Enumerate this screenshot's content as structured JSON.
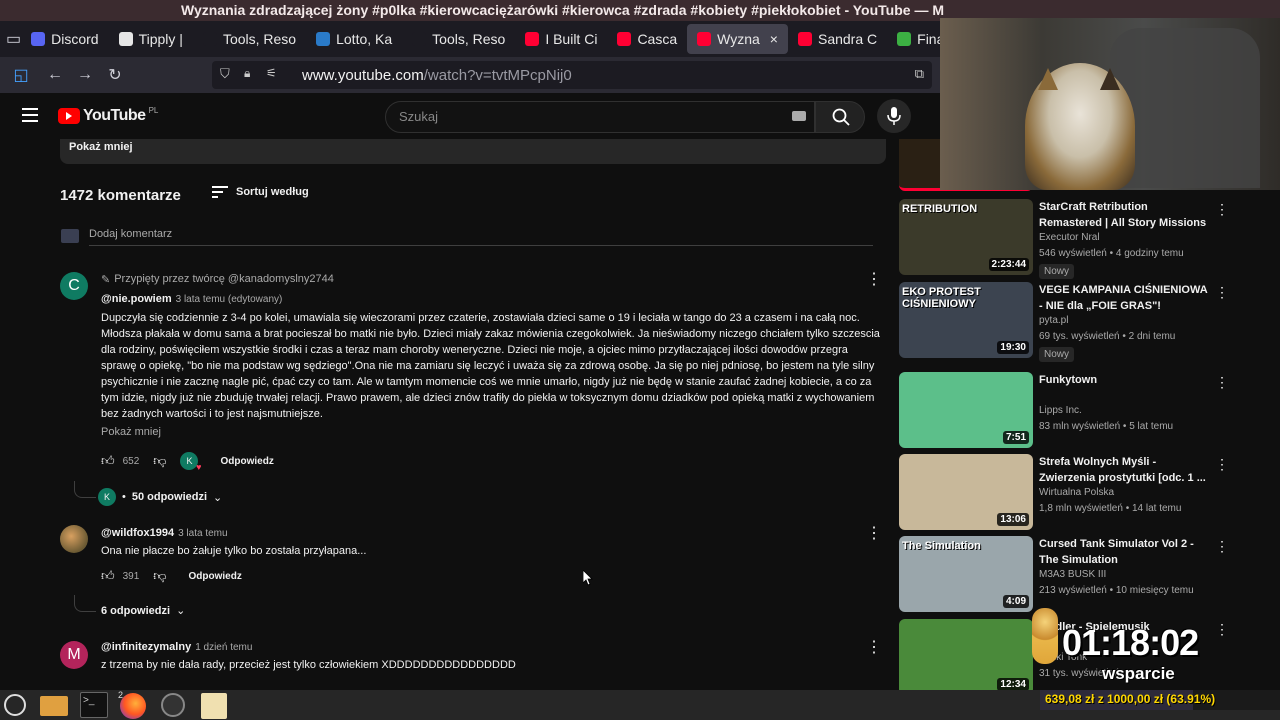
{
  "window": {
    "title": "Wyznania zdradzającej żony #p0lka #kierowcaciężarówki #kierowca #zdrada #kobiety #piekłokobiet - YouTube — M"
  },
  "tabs": [
    {
      "label": "Discord",
      "color": "#5865f2"
    },
    {
      "label": "Tipply |",
      "color": "#e6e6e6"
    },
    {
      "label": "Tools, Reso",
      "color": "#1c1b22"
    },
    {
      "label": "Lotto, Ka",
      "color": "#2a7ac8"
    },
    {
      "label": "Tools, Reso",
      "color": "#1c1b22"
    },
    {
      "label": "I Built Ci",
      "color": "#ff0033"
    },
    {
      "label": "Casca",
      "color": "#ff0033"
    },
    {
      "label": "Wyzna",
      "color": "#ff0033",
      "active": true,
      "close": "×"
    },
    {
      "label": "Sandra C",
      "color": "#ff0033"
    },
    {
      "label": "FinalBlac",
      "color": "#3cb043"
    }
  ],
  "nav": {
    "url_host": "www.youtube.com",
    "url_path": "/watch?v=tvtMPcpNij0"
  },
  "yt": {
    "logo": "YouTube",
    "region": "PL",
    "search_placeholder": "Szukaj"
  },
  "main": {
    "show_less_top": "Pokaż mniej",
    "comment_count": "1472 komentarze",
    "sort_label": "Sortuj według",
    "add_comment": "Dodaj komentarz",
    "comments": [
      {
        "avatar_letter": "C",
        "avatar_color": "#0f7b62",
        "pinned": "Przypięty przez twórcę @kanadomyslny2744",
        "author": "@nie.powiem",
        "meta": "3 lata temu (edytowany)",
        "text": "Dupczyła się codziennie z 3-4 po kolei, umawiala się wieczorami przez czaterie, zostawiała dzieci same o 19 i leciała w tango do 23 a czasem i na całą noc. Młodsza płakała w domu sama a brat pocieszał bo matki nie było. Dzieci miały zakaz mówienia czegokolwiek. Ja nieświadomy niczego chciałem tylko szczescia dla rodziny, poświęciłem wszystkie środki i czas a teraz mam choroby weneryczne. Dzieci nie moje, a ojciec mimo przytłaczającej ilości  dowodów przegra sprawę o opiekę, \"bo nie ma podstaw wg sędziego\".Ona nie ma zamiaru się leczyć i uważa się za zdrową osobę. Ja się po niej pdniosę, bo jestem na tyle silny psychicznie i nie zacznę nagle pić, ćpać czy co tam. Ale  w tamtym momencie coś we mnie umarło, nigdy już nie będę w stanie zaufać żadnej kobiecie, a co za tym idzie, nigdy już nie zbuduję trwałej relacji. Prawo prawem, ale dzieci znów trafiły do piekła w toksycznym domu dziadków  pod opieką matki z wychowaniem bez żadnych wartości i to jest najsmutniejsze.",
        "show_less": "Pokaż mniej",
        "likes": "652",
        "heart_letter": "K",
        "reply": "Odpowiedz",
        "replies_letter": "K",
        "replies": "50 odpowiedzi"
      },
      {
        "author": "@wildfox1994",
        "meta": "3 lata temu",
        "text": "Ona nie płacze bo żałuje tylko bo została przyłapana...",
        "likes": "391",
        "reply": "Odpowiedz",
        "replies": "6 odpowiedzi"
      },
      {
        "avatar_letter": "M",
        "avatar_color": "#b3245b",
        "author": "@infinitezymalny",
        "meta": "1 dzień temu",
        "text": "z trzema by nie dała rady, przecież jest tylko człowiekiem XDDDDDDDDDDDDDDDD"
      }
    ]
  },
  "sidebar": {
    "videos": [
      {
        "title": "StarCraft Retribution Remastered | All Story Missions",
        "channel": "Executor Nral",
        "stats": "546 wyświetleń • 4 godziny temu",
        "badge": "Nowy",
        "duration": "2:23:44",
        "thumb_text": "RETRIBUTION",
        "thumb_color": "#3b3a2a"
      },
      {
        "title": "VEGE KAMPANIA CIŚNIENIOWA - NIE dla „FOIE GRAS\"!",
        "channel": "pyta.pl",
        "stats": "69 tys. wyświetleń • 2 dni temu",
        "badge": "Nowy",
        "duration": "19:30",
        "thumb_text": "EKO PROTEST CIŚNIENIOWY",
        "thumb_color": "#3c4450"
      },
      {
        "title": "Funkytown",
        "channel": "Lipps Inc.",
        "stats": "83 mln wyświetleń • 5 lat temu",
        "duration": "7:51",
        "thumb_color": "#5cbf8a"
      },
      {
        "title": "Strefa Wolnych Myśli - Zwierzenia prostytutki [odc. 1 ...",
        "channel": "Wirtualna Polska",
        "stats": "1,8 mln wyświetleń • 14 lat temu",
        "duration": "13:06",
        "thumb_color": "#c8b89a"
      },
      {
        "title": "Cursed Tank Simulator Vol  2 - The Simulation",
        "channel": "M3A3 BUSK III",
        "stats": "213 wyświetleń • 10 miesięcy temu",
        "duration": "4:09",
        "thumb_text": "The Simulation",
        "thumb_color": "#9aa6ab"
      },
      {
        "title": "Siedler - Spielemusik",
        "channel": "Fonki Tonk",
        "stats": "31 tys. wyświetleń",
        "duration": "12:34",
        "thumb_color": "#4a8a3a"
      }
    ]
  },
  "overlay": {
    "timer": "01:18:02",
    "timer_label": "wsparcie",
    "donation": "639,08 zł z 1000,00 zł (63.91%)",
    "donation_fraction": 0.6391
  },
  "taskbar": {
    "badge": "2"
  }
}
